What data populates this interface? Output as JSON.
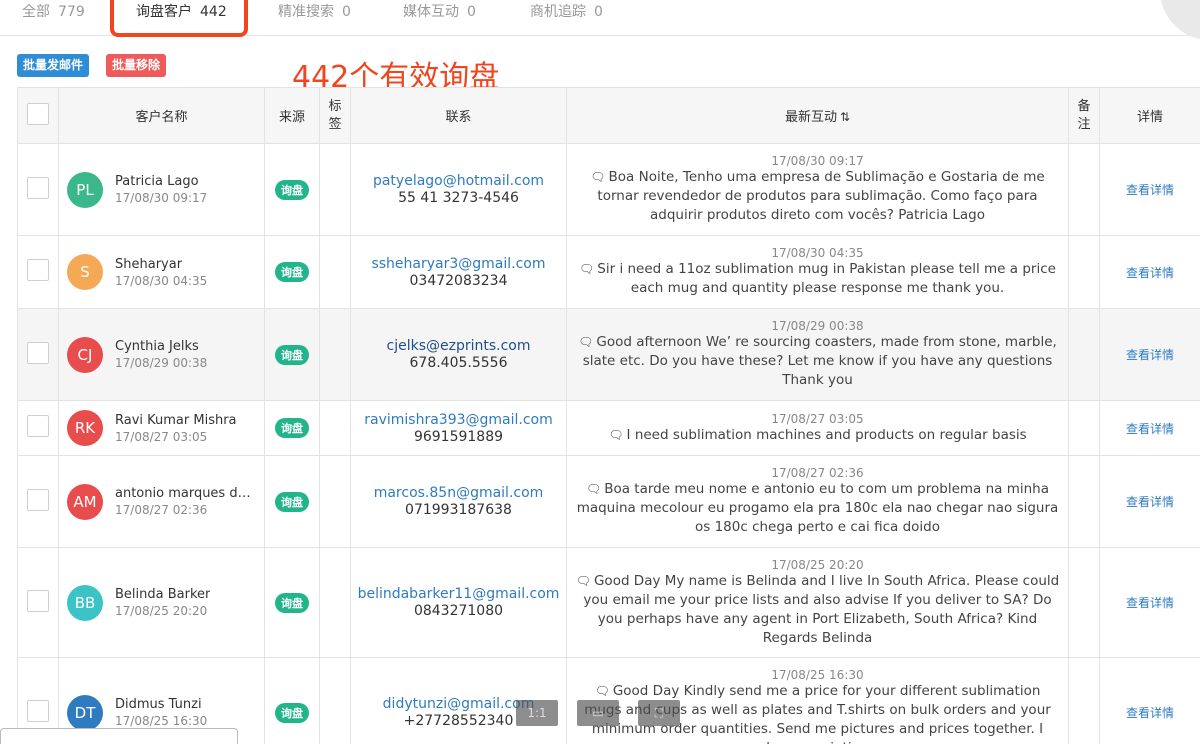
{
  "tabs": [
    {
      "label": "全部",
      "count": "779"
    },
    {
      "label": "询盘客户",
      "count": "442"
    },
    {
      "label": "精准搜索",
      "count": "0"
    },
    {
      "label": "媒体互动",
      "count": "0"
    },
    {
      "label": "商机追踪",
      "count": "0"
    }
  ],
  "actions": {
    "batch_email": "批量发邮件",
    "batch_remove": "批量移除"
  },
  "annotation": "442个有效询盘",
  "table": {
    "headers": {
      "name": "客户名称",
      "source": "来源",
      "tag": "标签",
      "contact": "联系",
      "latest": "最新互动",
      "latest_sort": "⇅",
      "note": "备注",
      "detail": "详情"
    },
    "rows": [
      {
        "initials": "PL",
        "color": "#3bb88a",
        "name": "Patricia Lago",
        "time": "17/08/30 09:17",
        "source": "询盘",
        "email": "patyelago@hotmail.com",
        "phone": "55 41 3273-4546",
        "itime": "17/08/30 09:17",
        "message": "Boa Noite, Tenho uma empresa de Sublimação e Gostaria de me tornar revendedor de produtos para sublimação. Como faço para adquirir produtos direto com vocês? Patricia Lago",
        "detail": "查看详情"
      },
      {
        "initials": "S",
        "color": "#f5a957",
        "name": "Sheharyar",
        "time": "17/08/30 04:35",
        "source": "询盘",
        "email": "ssheharyar3@gmail.com",
        "phone": "03472083234",
        "itime": "17/08/30 04:35",
        "message": "Sir i need a 11oz sublimation mug in Pakistan please tell me a price each mug and quantity please response me thank you.",
        "detail": "查看详情"
      },
      {
        "initials": "CJ",
        "color": "#e84c4c",
        "name": "Cynthia Jelks",
        "time": "17/08/29 00:38",
        "source": "询盘",
        "email": "cjelks@ezprints.com",
        "phone": "678.405.5556",
        "itime": "17/08/29 00:38",
        "message": "Good afternoon We’ re sourcing coasters, made from stone, marble, slate etc. Do you have these? Let me know if you have any questions Thank you",
        "detail": "查看详情"
      },
      {
        "initials": "RK",
        "color": "#e84c4c",
        "name": "Ravi Kumar Mishra",
        "time": "17/08/27 03:05",
        "source": "询盘",
        "email": "ravimishra393@gmail.com",
        "phone": "9691591889",
        "itime": "17/08/27 03:05",
        "message": "I need sublimation machines and products on regular basis",
        "detail": "查看详情"
      },
      {
        "initials": "AM",
        "color": "#e84c4c",
        "name": "antonio marques de j...",
        "time": "17/08/27 02:36",
        "source": "询盘",
        "email": "marcos.85n@gmail.com",
        "phone": "071993187638",
        "itime": "17/08/27 02:36",
        "message": "Boa tarde meu nome e antonio eu to com um problema na minha maquina mecolour eu progamo ela pra 180c ela nao chegar nao sigura os 180c chega perto e cai fica doido",
        "detail": "查看详情"
      },
      {
        "initials": "BB",
        "color": "#3cc3c6",
        "name": "Belinda Barker",
        "time": "17/08/25 20:20",
        "source": "询盘",
        "email": "belindabarker11@gmail.com",
        "phone": "0843271080",
        "itime": "17/08/25 20:20",
        "message": "Good Day My name is Belinda and I live In South Africa. Please could you email me your price lists and also advise If you deliver to SA? Do you perhaps have any agent in Port Elizabeth, South Africa? Kind Regards Belinda",
        "detail": "查看详情"
      },
      {
        "initials": "DT",
        "color": "#2f7bbf",
        "name": "Didmus Tunzi",
        "time": "17/08/25 16:30",
        "source": "询盘",
        "email": "didytunzi@gmail.com",
        "phone": "+27728552340",
        "itime": "17/08/25 16:30",
        "message": "Good Day Kindly send me a price for your different sublimation mugs and cups as well as plates and T.shirts on bulk orders and your minimum order quantities. Send me pictures and prices together. I have a printing",
        "detail": "查看详情"
      }
    ]
  },
  "viewer": {
    "zoom": "1:1"
  }
}
